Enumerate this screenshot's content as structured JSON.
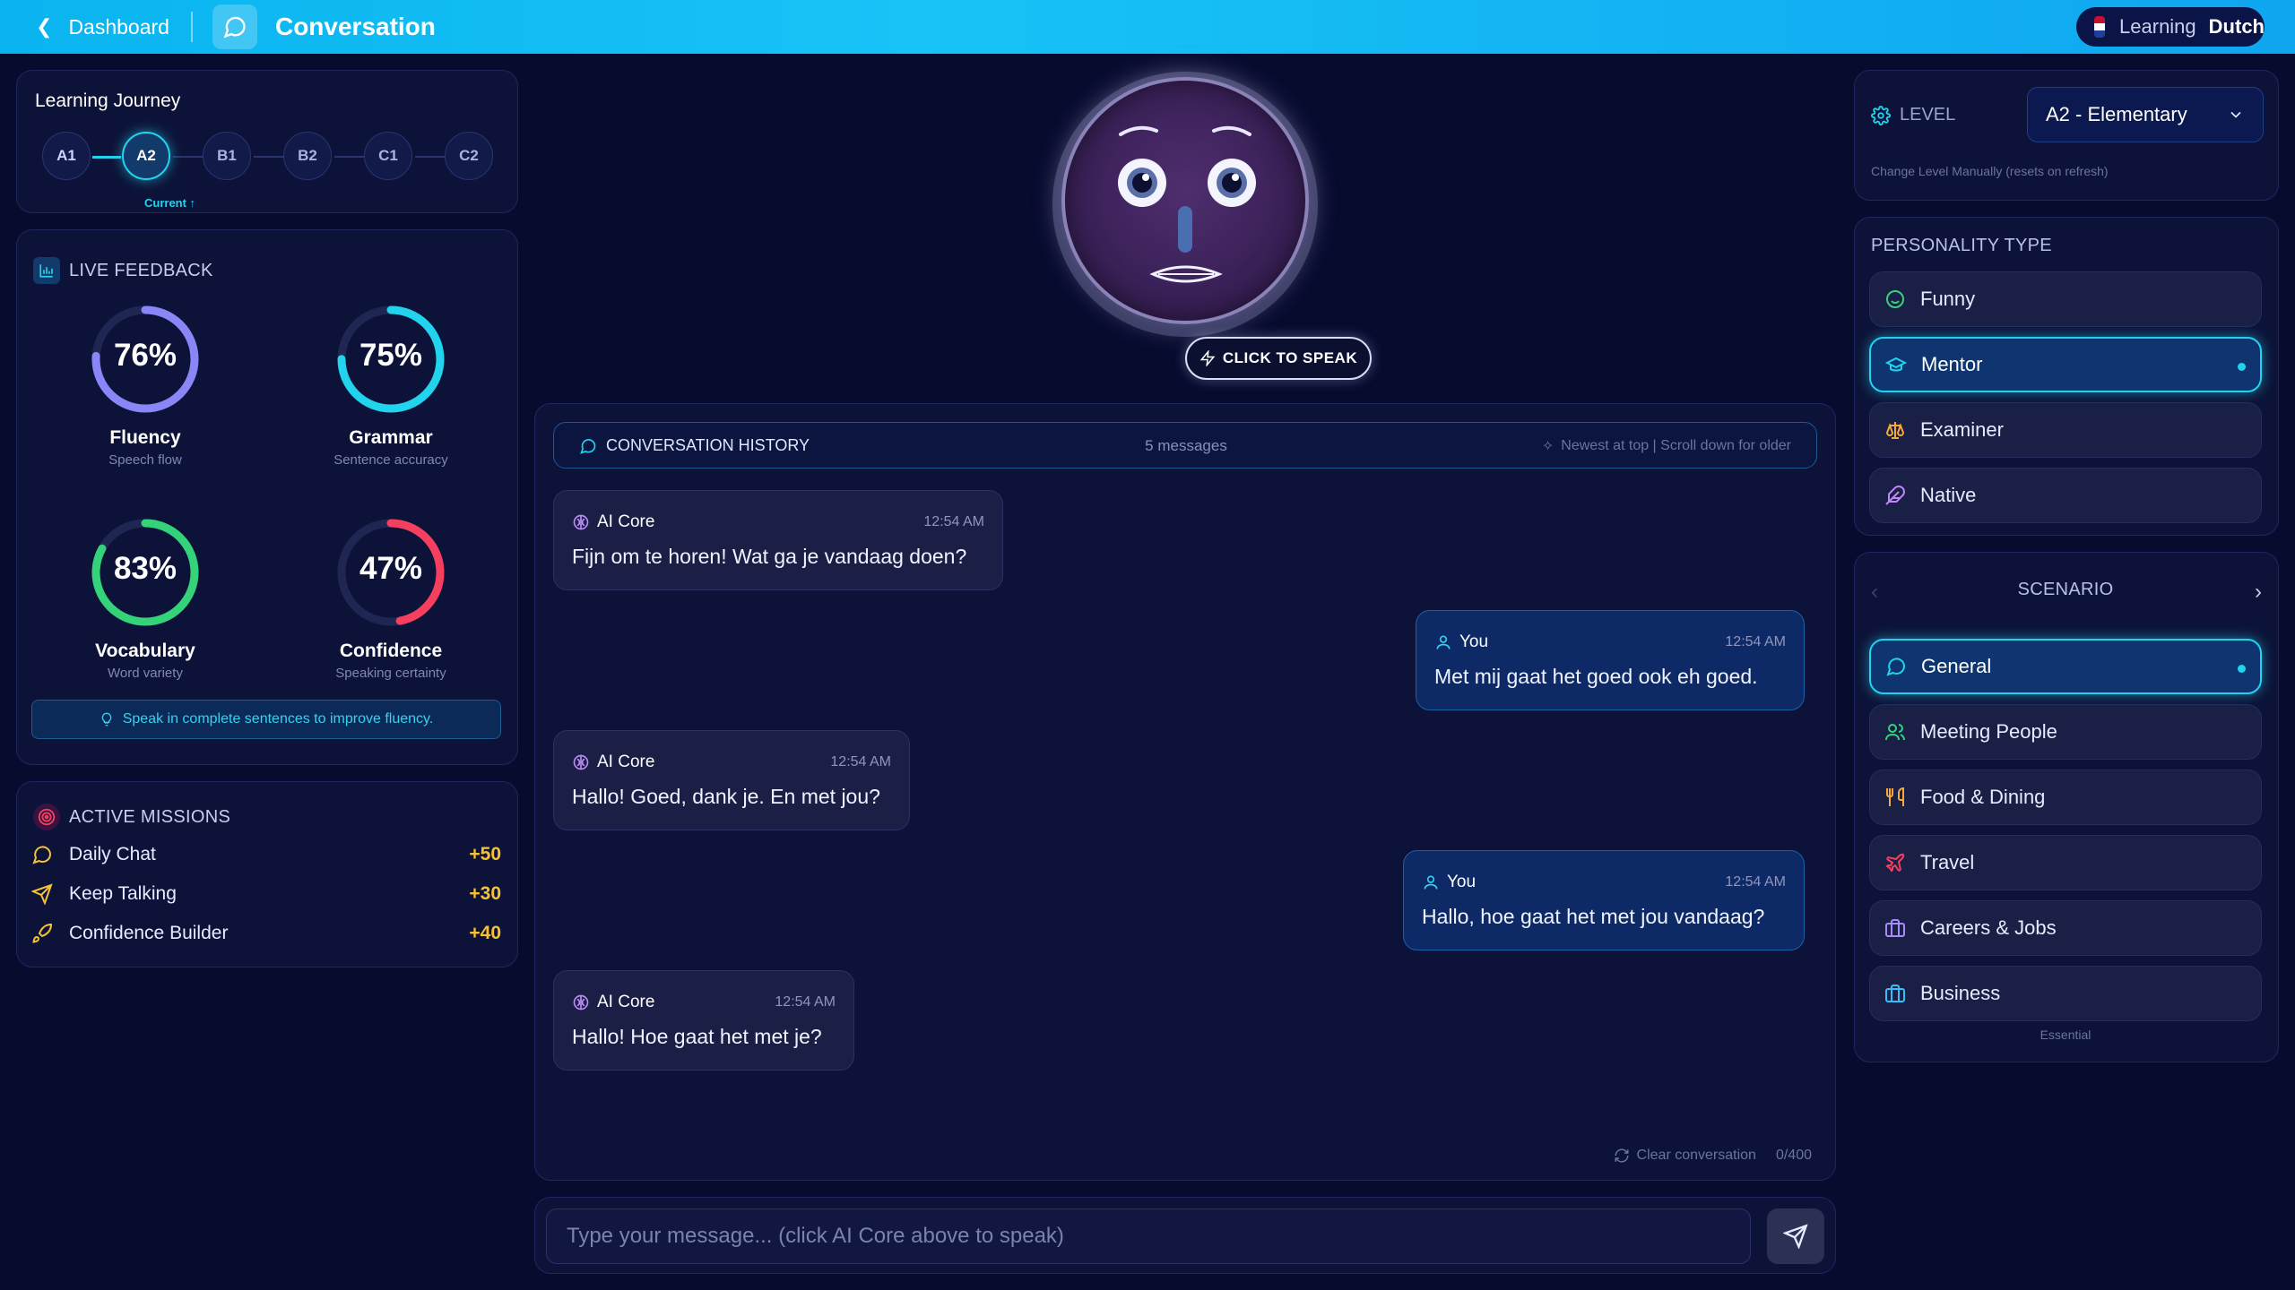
{
  "topbar": {
    "back_label": "Dashboard",
    "title": "Conversation",
    "learning_label": "Learning",
    "language": "Dutch"
  },
  "journey": {
    "title": "Learning Journey",
    "levels": [
      "A1",
      "A2",
      "B1",
      "B2",
      "C1",
      "C2"
    ],
    "current_index": 1,
    "current_label": "Current ↑"
  },
  "feedback": {
    "title": "LIVE FEEDBACK",
    "metrics": [
      {
        "label": "Fluency",
        "sub": "Speech flow",
        "value": 76,
        "pct": "76%",
        "color": "#8b86f7"
      },
      {
        "label": "Grammar",
        "sub": "Sentence accuracy",
        "value": 75,
        "pct": "75%",
        "color": "#22d3ee"
      },
      {
        "label": "Vocabulary",
        "sub": "Word variety",
        "value": 83,
        "pct": "83%",
        "color": "#34d37a"
      },
      {
        "label": "Confidence",
        "sub": "Speaking certainty",
        "value": 47,
        "pct": "47%",
        "color": "#f43f5e"
      }
    ],
    "tip": "Speak in complete sentences to improve fluency."
  },
  "missions": {
    "title": "ACTIVE MISSIONS",
    "items": [
      {
        "label": "Daily Chat",
        "points": "+50"
      },
      {
        "label": "Keep Talking",
        "points": "+30"
      },
      {
        "label": "Confidence Builder",
        "points": "+40"
      }
    ]
  },
  "avatar": {
    "speak_label": "CLICK TO SPEAK"
  },
  "history": {
    "title": "CONVERSATION HISTORY",
    "count": "5 messages",
    "note": "Newest at top | Scroll down for older",
    "messages": [
      {
        "from": "AI Core",
        "time": "12:54 AM",
        "text": "Fijn om te horen! Wat ga je vandaag doen?"
      },
      {
        "from": "You",
        "time": "12:54 AM",
        "text": "Met mij gaat het goed ook eh goed."
      },
      {
        "from": "AI Core",
        "time": "12:54 AM",
        "text": "Hallo! Goed, dank je. En met jou?"
      },
      {
        "from": "You",
        "time": "12:54 AM",
        "text": "Hallo, hoe gaat het met jou vandaag?"
      },
      {
        "from": "AI Core",
        "time": "12:54 AM",
        "text": "Hallo! Hoe gaat het met je?"
      }
    ],
    "clear_label": "Clear conversation",
    "char_count": "0/400"
  },
  "composer": {
    "placeholder": "Type your message... (click AI Core above to speak)",
    "value": ""
  },
  "level": {
    "label": "LEVEL",
    "selected": "A2 - Elementary",
    "note": "Change Level Manually (resets on refresh)"
  },
  "personality": {
    "title": "PERSONALITY TYPE",
    "options": [
      "Funny",
      "Mentor",
      "Examiner",
      "Native"
    ],
    "selected": "Mentor"
  },
  "scenario": {
    "title": "SCENARIO",
    "options": [
      "General",
      "Meeting People",
      "Food & Dining",
      "Travel",
      "Careers & Jobs",
      "Business"
    ],
    "selected": "General",
    "footer": "Essential"
  },
  "colors": {
    "accent": "#22d3ee",
    "topbar": "#0ab4f0",
    "points": "#f6c235",
    "background": "#070b2e"
  }
}
